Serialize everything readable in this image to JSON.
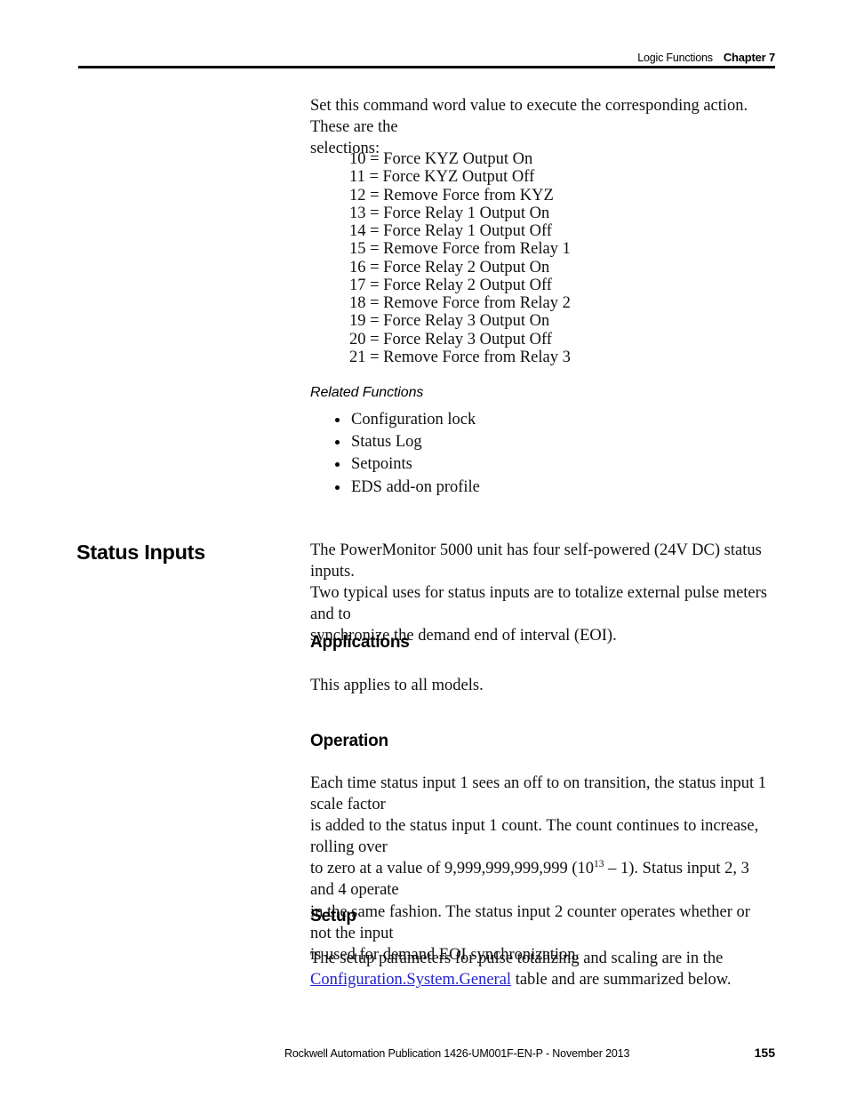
{
  "header": {
    "section_title": "Logic Functions",
    "chapter_label": "Chapter 7"
  },
  "intro": {
    "paragraph_line1": "Set this command word value to execute the corresponding action. These are the",
    "paragraph_line2": "selections:"
  },
  "command_selections": [
    "10 = Force KYZ Output On",
    "11 = Force KYZ Output Off",
    "12 = Remove Force from KYZ",
    "13 = Force Relay 1 Output On",
    "14 = Force Relay 1 Output Off",
    "15 = Remove Force from Relay 1",
    "16 = Force Relay 2 Output On",
    "17 = Force Relay 2 Output Off",
    "18 = Remove Force from Relay 2",
    "19 = Force Relay 3 Output On",
    "20 = Force Relay 3 Output Off",
    "21 = Remove Force from Relay 3"
  ],
  "related_functions": {
    "heading": "Related Functions",
    "items": [
      "Configuration lock",
      "Status Log",
      "Setpoints",
      "EDS add-on profile"
    ]
  },
  "status_inputs": {
    "margin_heading": "Status Inputs",
    "intro_line1": "The PowerMonitor 5000 unit has four self-powered (24V DC) status inputs.",
    "intro_line2": "Two typical uses for status inputs are to totalize external pulse meters and to",
    "intro_line3": "synchronize the demand end of interval (EOI)."
  },
  "applications": {
    "heading": "Applications",
    "body": "This applies to all models."
  },
  "operation": {
    "heading": "Operation",
    "line1": "Each time status input 1 sees an off to on transition, the status input 1 scale factor",
    "line2": "is added to the status input 1 count. The count continues to increase, rolling over",
    "line3_pre": "to zero at a value of 9,999,999,999,999 (10",
    "line3_exponent": "13",
    "line3_post": " – 1). Status input 2, 3 and 4 operate",
    "line4": "in the same fashion. The status input 2 counter operates whether or not the input",
    "line5": "is used for demand EOI synchronization."
  },
  "setup": {
    "heading": "Setup",
    "line1": "The setup parameters for pulse totalizing and scaling are in the",
    "link_text": "Configuration.System.General",
    "line2_post": " table and are summarized below."
  },
  "footer": {
    "publication": "Rockwell Automation Publication 1426-UM001F-EN-P - November 2013",
    "page_number": "155"
  },
  "colors": {
    "link": "#2222cc",
    "text": "#111111",
    "rule": "#000000"
  }
}
